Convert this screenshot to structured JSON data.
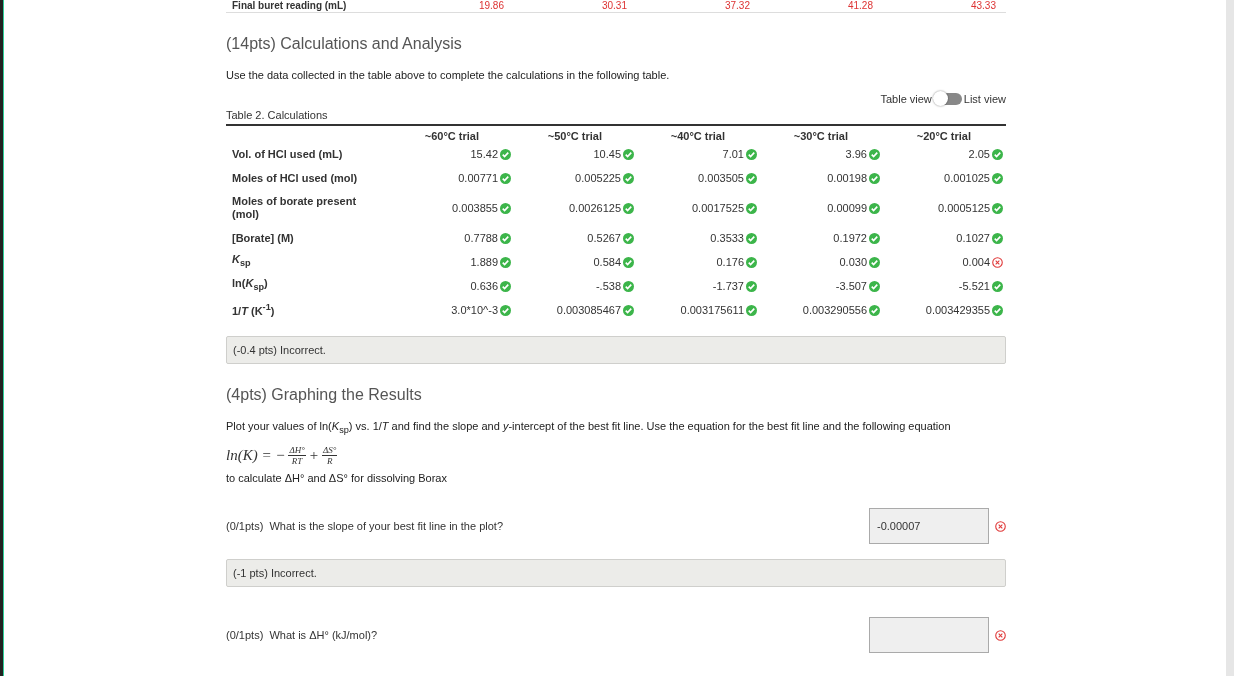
{
  "previous_row": {
    "label": "Final buret reading (mL)",
    "values": [
      "19.86",
      "30.31",
      "37.32",
      "41.28",
      "43.33"
    ]
  },
  "calc_section": {
    "title": "(14pts) Calculations and Analysis",
    "instructions": "Use the data collected in the table above to complete the calculations in the following table.",
    "view_toggle": {
      "left_label": "Table view",
      "right_label": "List view",
      "on": false
    },
    "table": {
      "caption": "Table 2. Calculations",
      "columns": [
        "~60°C trial",
        "~50°C trial",
        "~40°C trial",
        "~30°C trial",
        "~20°C trial"
      ],
      "rows": [
        {
          "label": "Vol. of HCl used (mL)",
          "cells": [
            {
              "value": "15.42",
              "correct": true
            },
            {
              "value": "10.45",
              "correct": true
            },
            {
              "value": "7.01",
              "correct": true
            },
            {
              "value": "3.96",
              "correct": true
            },
            {
              "value": "2.05",
              "correct": true
            }
          ]
        },
        {
          "label": "Moles of HCl used (mol)",
          "cells": [
            {
              "value": "0.00771",
              "correct": true
            },
            {
              "value": "0.005225",
              "correct": true
            },
            {
              "value": "0.003505",
              "correct": true
            },
            {
              "value": "0.00198",
              "correct": true
            },
            {
              "value": "0.001025",
              "correct": true
            }
          ]
        },
        {
          "label": "Moles of borate present (mol)",
          "cells": [
            {
              "value": "0.003855",
              "correct": true
            },
            {
              "value": "0.0026125",
              "correct": true
            },
            {
              "value": "0.0017525",
              "correct": true
            },
            {
              "value": "0.00099",
              "correct": true
            },
            {
              "value": "0.0005125",
              "correct": true
            }
          ]
        },
        {
          "label": "[Borate] (M)",
          "cells": [
            {
              "value": "0.7788",
              "correct": true
            },
            {
              "value": "0.5267",
              "correct": true
            },
            {
              "value": "0.3533",
              "correct": true
            },
            {
              "value": "0.1972",
              "correct": true
            },
            {
              "value": "0.1027",
              "correct": true
            }
          ]
        },
        {
          "label": "*K*$_{sp}$",
          "cells": [
            {
              "value": "1.889",
              "correct": true
            },
            {
              "value": "0.584",
              "correct": true
            },
            {
              "value": "0.176",
              "correct": true
            },
            {
              "value": "0.030",
              "correct": true
            },
            {
              "value": "0.004",
              "correct": false
            }
          ]
        },
        {
          "label": "ln(*K*$_{sp}$)",
          "cells": [
            {
              "value": "0.636",
              "correct": true
            },
            {
              "value": "-.538",
              "correct": true
            },
            {
              "value": "-1.737",
              "correct": true
            },
            {
              "value": "-3.507",
              "correct": true
            },
            {
              "value": "-5.521",
              "correct": true
            }
          ]
        },
        {
          "label": "1/*T* (K$^{-1}$)",
          "cells": [
            {
              "value": "3.0*10^-3",
              "correct": true
            },
            {
              "value": "0.003085467",
              "correct": true
            },
            {
              "value": "0.003175611",
              "correct": true
            },
            {
              "value": "0.003290556",
              "correct": true
            },
            {
              "value": "0.003429355",
              "correct": true
            }
          ]
        }
      ]
    },
    "feedback": "(-0.4 pts) Incorrect."
  },
  "graph_section": {
    "title": "(4pts) Graphing the Results",
    "instructions": "Plot your values of ln(*K*$_{sp}$) vs. 1/*T* and find the slope and *y*-intercept of the best fit line. Use the equation for the best fit line and the following equation",
    "equation": {
      "lhs": "ln(K) = −",
      "term1": {
        "numerator": "ΔH°",
        "denominator": "RT"
      },
      "operator": "+",
      "term2": {
        "numerator": "ΔS°",
        "denominator": "R"
      }
    },
    "after_equation": "to calculate ΔH° and ΔS° for dissolving Borax",
    "questions": [
      {
        "points": "(0/1pts)",
        "prompt": "What is the slope of your best fit line in the plot?",
        "answer": "-0.00007",
        "correct": false,
        "feedback": "(-1 pts) Incorrect."
      },
      {
        "points": "(0/1pts)",
        "prompt": "What is ΔH° (kJ/mol)?",
        "correct": false
      }
    ]
  }
}
